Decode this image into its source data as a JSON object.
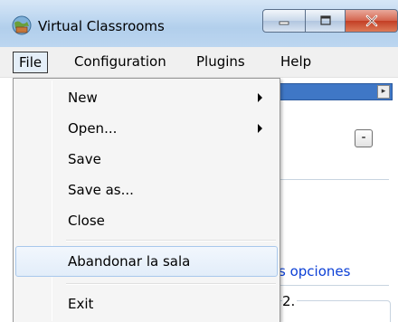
{
  "window": {
    "title": "Virtual Classrooms",
    "icon": "globe-classroom-icon",
    "buttons": [
      "minimize-icon",
      "maximize-icon",
      "close-icon"
    ]
  },
  "menubar": {
    "items": [
      {
        "label": "File",
        "active": true
      },
      {
        "label": "Configuration"
      },
      {
        "label": "Plugins"
      },
      {
        "label": "Help"
      }
    ]
  },
  "file_menu": {
    "items": [
      {
        "label": "New",
        "submenu": true
      },
      {
        "label": "Open...",
        "submenu": true
      },
      {
        "label": "Save"
      },
      {
        "label": "Save as..."
      },
      {
        "label": "Close"
      },
      {
        "label": "Abandonar la sala",
        "highlighted": true
      },
      {
        "label": "Exit"
      }
    ]
  },
  "background": {
    "collapse_symbol": "-",
    "options_link": "s opciones",
    "section_label": "2.",
    "accent_color": "#3f77c6"
  }
}
